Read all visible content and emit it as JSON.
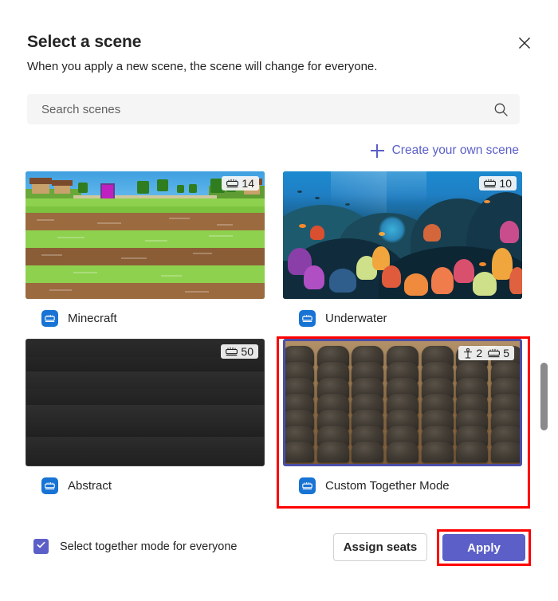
{
  "dialog": {
    "title": "Select a scene",
    "subtitle": "When you apply a new scene, the scene will change for everyone.",
    "close_icon": "close-icon"
  },
  "search": {
    "placeholder": "Search scenes",
    "value": "",
    "icon": "search-icon"
  },
  "create_scene": {
    "label": "Create your own scene",
    "icon": "plus-icon",
    "color": "#5b5fc7"
  },
  "scenes": [
    {
      "name": "Minecraft",
      "badge_seats": "14",
      "badge_presenters": "",
      "selected": false,
      "icon": "together-mode-seats-icon"
    },
    {
      "name": "Underwater",
      "badge_seats": "10",
      "badge_presenters": "",
      "selected": false,
      "icon": "together-mode-seats-icon"
    },
    {
      "name": "Abstract",
      "badge_seats": "50",
      "badge_presenters": "",
      "selected": false,
      "icon": "together-mode-seats-icon"
    },
    {
      "name": "Custom Together Mode",
      "badge_seats": "5",
      "badge_presenters": "2",
      "selected": true,
      "icon": "together-mode-seats-icon"
    }
  ],
  "footer": {
    "checkbox_label": "Select together mode for everyone",
    "checkbox_checked": true,
    "assign_seats_label": "Assign seats",
    "apply_label": "Apply"
  },
  "colors": {
    "accent": "#5b5fc7",
    "scene_icon_blue": "#1773d4",
    "selection_border": "#4a4ea8",
    "annotation_red": "#ff0000"
  }
}
